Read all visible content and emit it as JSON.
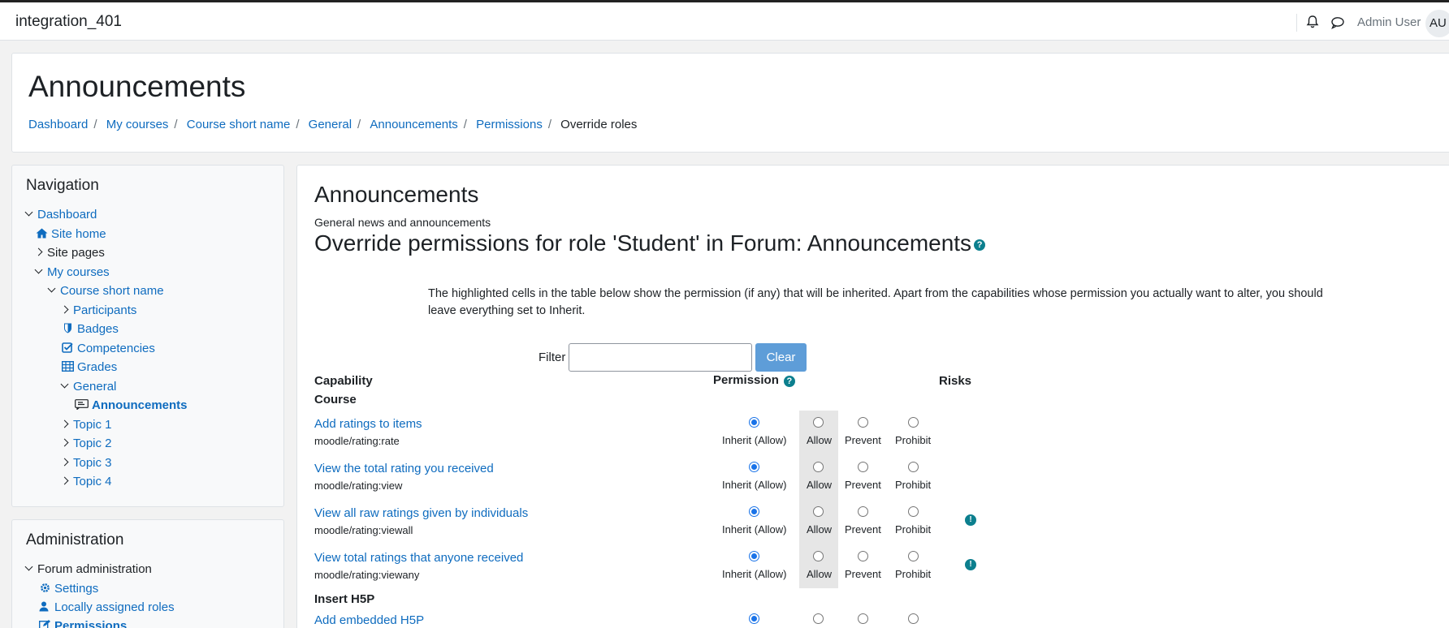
{
  "topbar": {
    "site_name": "integration_401",
    "user_name": "Admin User",
    "avatar_initials": "AU",
    "icons": [
      "bell-icon",
      "chat-icon"
    ]
  },
  "header": {
    "title": "Announcements",
    "breadcrumbs": [
      "Dashboard",
      "My courses",
      "Course short name",
      "General",
      "Announcements",
      "Permissions"
    ],
    "current": "Override roles"
  },
  "navigation": {
    "title": "Navigation",
    "items": [
      {
        "label": "Dashboard",
        "icon": "chevron-down"
      },
      {
        "label": "Site home",
        "icon": "home-icon"
      },
      {
        "label": "Site pages",
        "icon": "chevron-right"
      },
      {
        "label": "My courses",
        "icon": "chevron-down"
      },
      {
        "label": "Course short name",
        "icon": "chevron-down"
      },
      {
        "label": "Participants",
        "icon": "chevron-right"
      },
      {
        "label": "Badges",
        "icon": "shield-icon"
      },
      {
        "label": "Competencies",
        "icon": "checkbox-icon"
      },
      {
        "label": "Grades",
        "icon": "table-icon"
      },
      {
        "label": "General",
        "icon": "chevron-down"
      },
      {
        "label": "Announcements",
        "icon": "forum-icon"
      },
      {
        "label": "Topic 1",
        "icon": "chevron-right"
      },
      {
        "label": "Topic 2",
        "icon": "chevron-right"
      },
      {
        "label": "Topic 3",
        "icon": "chevron-right"
      },
      {
        "label": "Topic 4",
        "icon": "chevron-right"
      }
    ]
  },
  "administration": {
    "title": "Administration",
    "items": [
      {
        "label": "Forum administration",
        "icon": "chevron-down"
      },
      {
        "label": "Settings",
        "icon": "gear-icon"
      },
      {
        "label": "Locally assigned roles",
        "icon": "user-icon"
      },
      {
        "label": "Permissions",
        "icon": "edit-icon"
      }
    ]
  },
  "main": {
    "title": "Announcements",
    "description": "General news and announcements",
    "heading": "Override permissions for role 'Student' in Forum: Announcements",
    "intro": "The highlighted cells in the table below show the permission (if any) that will be inherited. Apart from the capabilities whose permission you actually want to alter, you should leave everything set to Inherit.",
    "filter_label": "Filter",
    "filter_value": "",
    "clear_label": "Clear",
    "columns": {
      "capability": "Capability",
      "permission": "Permission",
      "risks": "Risks"
    },
    "groups": [
      {
        "name": "Course"
      },
      {
        "name": "Insert H5P"
      }
    ],
    "permission_options": [
      "Inherit (Allow)",
      "Allow",
      "Prevent",
      "Prohibit"
    ],
    "capabilities": [
      {
        "name": "Add ratings to items",
        "code": "moodle/rating:rate",
        "selected": "Inherit (Allow)",
        "risk": false
      },
      {
        "name": "View the total rating you received",
        "code": "moodle/rating:view",
        "selected": "Inherit (Allow)",
        "risk": false
      },
      {
        "name": "View all raw ratings given by individuals",
        "code": "moodle/rating:viewall",
        "selected": "Inherit (Allow)",
        "risk": true
      },
      {
        "name": "View total ratings that anyone received",
        "code": "moodle/rating:viewany",
        "selected": "Inherit (Allow)",
        "risk": true
      },
      {
        "name": "Add embedded H5P",
        "code": "",
        "selected": "Inherit (Allow)",
        "risk": false
      }
    ]
  }
}
